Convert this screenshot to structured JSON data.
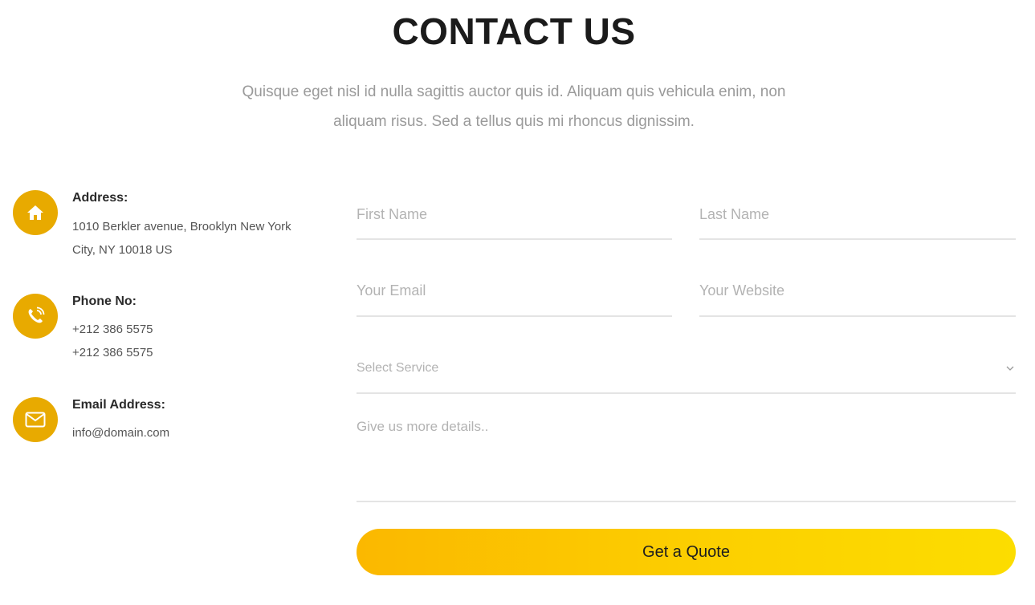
{
  "section": {
    "title": "CONTACT US",
    "subtitle_line1": "Quisque eget nisl id nulla sagittis auctor quis id. Aliquam quis vehicula enim, non",
    "subtitle_line2": "aliquam risus. Sed a tellus quis mi rhoncus dignissim."
  },
  "contact_info": {
    "address": {
      "icon": "home-icon",
      "heading": "Address:",
      "line1": "1010 Berkler avenue, Brooklyn New York",
      "line2": "City, NY 10018 US"
    },
    "phone": {
      "icon": "phone-icon",
      "heading": "Phone No:",
      "line1": "+212 386 5575",
      "line2": "+212 386 5575"
    },
    "email": {
      "icon": "envelope-icon",
      "heading": "Email Address:",
      "line1": "info@domain.com"
    }
  },
  "form": {
    "first_name": {
      "placeholder": "First Name",
      "value": ""
    },
    "last_name": {
      "placeholder": "Last Name",
      "value": ""
    },
    "email": {
      "placeholder": "Your Email",
      "value": ""
    },
    "website": {
      "placeholder": "Your Website",
      "value": ""
    },
    "service": {
      "selected": "Select Service"
    },
    "details": {
      "placeholder": "Give us more details..",
      "value": ""
    },
    "submit_label": "Get a Quote"
  },
  "colors": {
    "accent": "#e8aa00",
    "button_gradient_start": "#fbb800",
    "button_gradient_end": "#fcdd00"
  }
}
